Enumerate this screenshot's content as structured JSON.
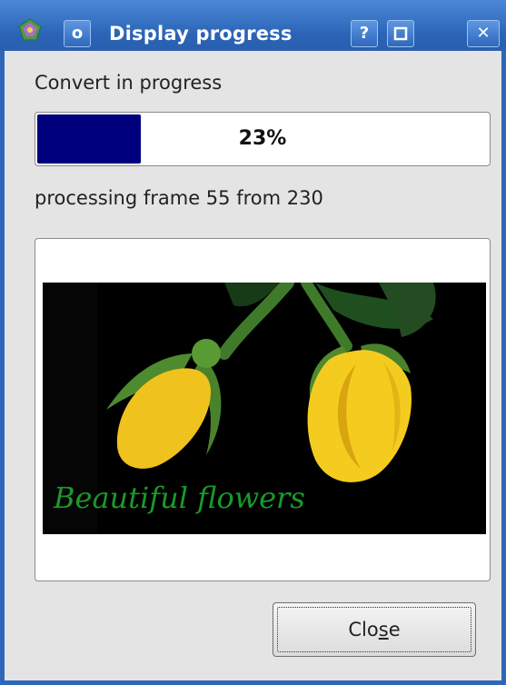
{
  "window": {
    "title": "Display progress",
    "buttons": {
      "menu": "o",
      "help": "?",
      "close": "✕"
    }
  },
  "status": {
    "label": "Convert in progress",
    "progress_fraction": 0.23,
    "progress_text": "23%",
    "frame_text": "processing frame 55 from 230"
  },
  "preview": {
    "caption": "Beautiful flowers"
  },
  "close_button": {
    "before": "Clo",
    "mnemonic": "s",
    "after": "e"
  },
  "colors": {
    "titlebar": "#2f67b8",
    "progress_fill": "#00007f",
    "caption": "#1a9a2a"
  }
}
